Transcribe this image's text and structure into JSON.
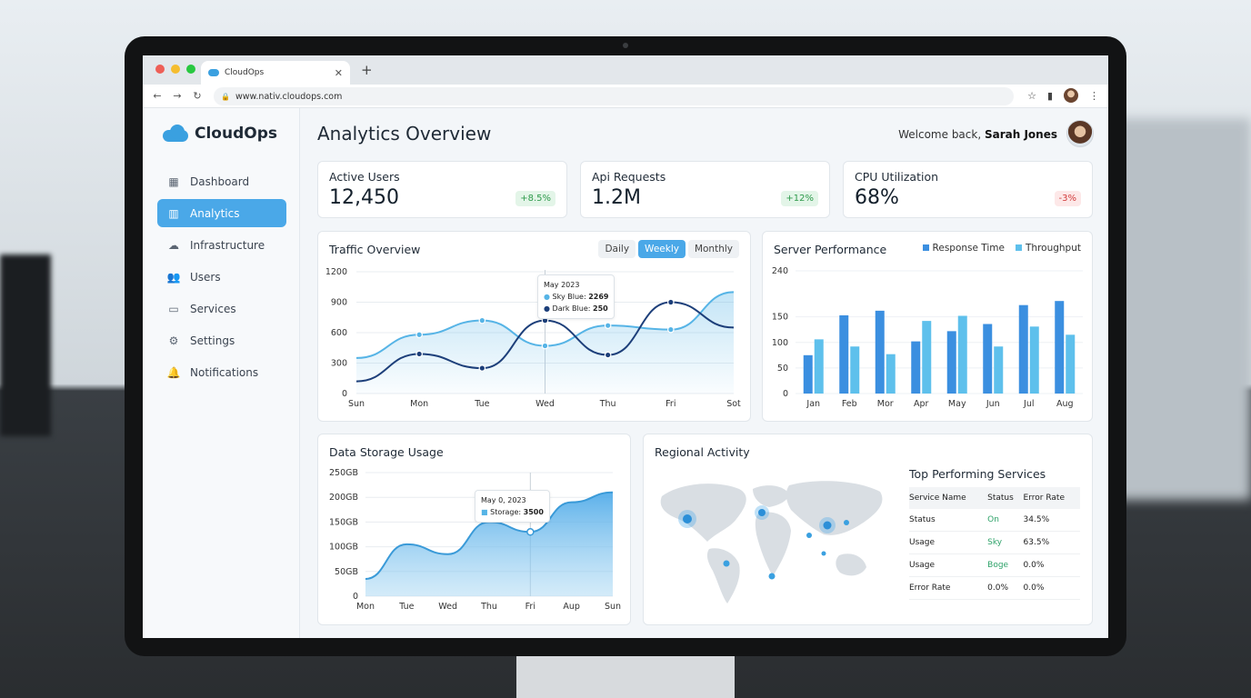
{
  "browser": {
    "tab_title": "CloudOps",
    "url": "www.nativ.cloudops.com"
  },
  "app": {
    "name": "CloudOps"
  },
  "sidebar": {
    "items": [
      {
        "label": "Dashboard",
        "icon": "grid-icon"
      },
      {
        "label": "Analytics",
        "icon": "chart-icon",
        "active": true
      },
      {
        "label": "Infrastructure",
        "icon": "cloud-upload-icon"
      },
      {
        "label": "Users",
        "icon": "users-icon"
      },
      {
        "label": "Services",
        "icon": "briefcase-icon"
      },
      {
        "label": "Settings",
        "icon": "gear-icon"
      },
      {
        "label": "Notifications",
        "icon": "bell-icon"
      }
    ]
  },
  "header": {
    "title": "Analytics Overview",
    "welcome": "Welcome back,",
    "user_name": "Sarah Jones"
  },
  "stats": [
    {
      "label": "Active Users",
      "value": "12,450",
      "change": "+8.5%",
      "trend": "up"
    },
    {
      "label": "Api Requests",
      "value": "1.2M",
      "change": "+12%",
      "trend": "up"
    },
    {
      "label": "CPU Utilization",
      "value": "68%",
      "change": "-3%",
      "trend": "down"
    }
  ],
  "traffic": {
    "title": "Traffic Overview",
    "periods": [
      "Daily",
      "Weekly",
      "Monthly"
    ],
    "active_period": "Weekly",
    "tooltip": {
      "date": "May 2023",
      "a_label": "Sky Blue:",
      "a_value": "2269",
      "b_label": "Dark Blue:",
      "b_value": "250"
    }
  },
  "server": {
    "title": "Server Performance",
    "legend": [
      "Response Time",
      "Throughput"
    ]
  },
  "storage": {
    "title": "Data Storage Usage",
    "tooltip": {
      "date": "May 0, 2023",
      "label": "Storage:",
      "value": "3500"
    }
  },
  "regional": {
    "title": "Regional Activity",
    "table_title": "Top Performing Services",
    "columns": [
      "Service Name",
      "Status",
      "Error Rate"
    ],
    "rows": [
      [
        "Status",
        "On",
        "34.5%"
      ],
      [
        "Usage",
        "Sky",
        "63.5%"
      ],
      [
        "Usage",
        "Boge",
        "0.0%"
      ],
      [
        "Error Rate",
        "0.0%",
        "0.0%"
      ]
    ]
  },
  "colors": {
    "accent": "#4aa8e8",
    "sky_blue": "#56b4e6",
    "dark_blue": "#1d3f7a",
    "bar_dark": "#3b8fe0",
    "bar_light": "#5ec0ec",
    "positive": "#2e9a4b",
    "negative": "#d23c3c"
  },
  "chart_data": [
    {
      "type": "line",
      "title": "Traffic Overview",
      "categories": [
        "Sun",
        "Mon",
        "Tue",
        "Wed",
        "Thu",
        "Fri",
        "Sot"
      ],
      "ylim": [
        0,
        1200
      ],
      "yticks": [
        0,
        300,
        600,
        900,
        1200
      ],
      "series": [
        {
          "name": "Sky Blue",
          "values": [
            350,
            580,
            720,
            470,
            670,
            630,
            1000
          ]
        },
        {
          "name": "Dark Blue",
          "values": [
            120,
            390,
            250,
            720,
            380,
            900,
            650
          ]
        }
      ],
      "grid": true
    },
    {
      "type": "bar",
      "title": "Server Performance",
      "categories": [
        "Jan",
        "Feb",
        "Mor",
        "Apr",
        "May",
        "Jun",
        "Jul",
        "Aug"
      ],
      "ylim": [
        0,
        240
      ],
      "yticks": [
        0,
        50,
        100,
        150,
        240
      ],
      "series": [
        {
          "name": "Response Time",
          "values": [
            75,
            153,
            162,
            102,
            122,
            136,
            173,
            181
          ]
        },
        {
          "name": "Throughput",
          "values": [
            106,
            92,
            77,
            142,
            152,
            92,
            131,
            115
          ]
        }
      ],
      "legend": "top-right"
    },
    {
      "type": "area",
      "title": "Data Storage Usage",
      "categories": [
        "Mon",
        "Tue",
        "Wed",
        "Thu",
        "Fri",
        "Aup",
        "Sun"
      ],
      "yticks": [
        "0",
        "50GB",
        "100GB",
        "150GB",
        "200GB",
        "250GB"
      ],
      "ylim": [
        0,
        250
      ],
      "values": [
        35,
        105,
        85,
        150,
        130,
        190,
        210
      ]
    }
  ]
}
